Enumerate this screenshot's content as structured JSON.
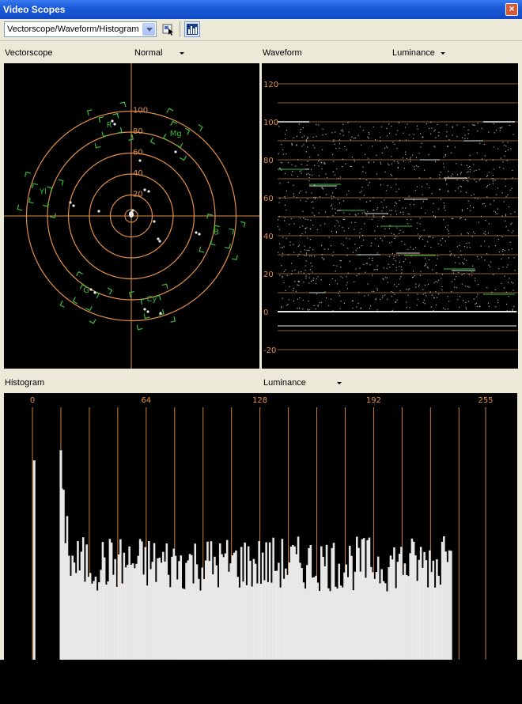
{
  "window": {
    "title": "Video Scopes"
  },
  "toolbar": {
    "mode_value": "Vectorscope/Waveform/Histogram"
  },
  "vectorscope": {
    "label": "Vectorscope",
    "mode": "Normal",
    "ring_labels": [
      "20",
      "40",
      "60",
      "80",
      "100"
    ],
    "targets": [
      {
        "label": "R",
        "angle": 103
      },
      {
        "label": "Mg",
        "angle": 61
      },
      {
        "label": "B",
        "angle": -13
      },
      {
        "label": "Cy",
        "angle": -77
      },
      {
        "label": "G",
        "angle": -119
      },
      {
        "label": "Yl",
        "angle": 167
      }
    ]
  },
  "waveform": {
    "label": "Waveform",
    "mode": "Luminance",
    "scale_labels": [
      "120",
      "100",
      "80",
      "60",
      "40",
      "20",
      "0",
      "-20"
    ]
  },
  "histogram": {
    "label": "Histogram",
    "mode": "Luminance",
    "axis_labels": [
      "0",
      "64",
      "128",
      "192",
      "255"
    ]
  },
  "chart_data": {
    "type": "bar",
    "title": "",
    "xlabel": "",
    "ylabel": "",
    "xlim": [
      0,
      255
    ],
    "x_ticks": [
      0,
      64,
      128,
      192,
      255
    ],
    "peaks": [
      {
        "x": 1,
        "value": 0.79
      },
      {
        "x": 16,
        "value": 0.83
      }
    ],
    "profile_range": [
      15,
      235
    ],
    "profile_typical_value": 0.38,
    "profile_peak_near_235": 0.53
  },
  "colors": {
    "scope_orange": "#e0904a",
    "target_green": "#3bbb3b",
    "trace_white": "#e8e8e8"
  }
}
